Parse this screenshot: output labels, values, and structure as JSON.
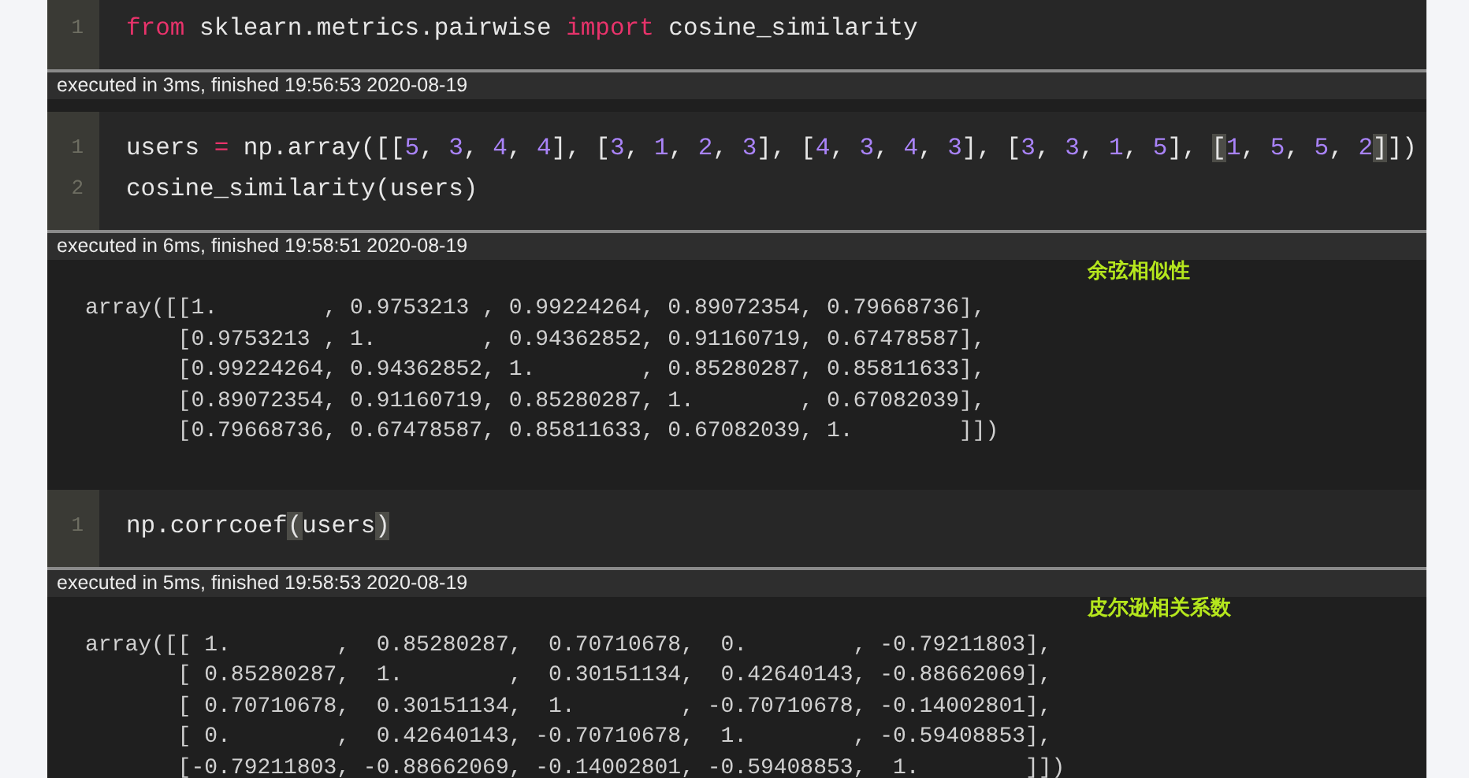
{
  "cells": [
    {
      "input": [
        {
          "number": "1",
          "tokens": [
            {
              "kind": "keyword",
              "text": "from"
            },
            {
              "kind": "plain",
              "text": " sklearn.metrics.pairwise "
            },
            {
              "kind": "keyword",
              "text": "import"
            },
            {
              "kind": "plain",
              "text": " cosine_similarity"
            }
          ]
        }
      ],
      "execution": "executed in 3ms, finished 19:56:53 2020-08-19"
    },
    {
      "input": [
        {
          "number": "1",
          "tokens": [
            {
              "kind": "plain",
              "text": "users "
            },
            {
              "kind": "operator",
              "text": "="
            },
            {
              "kind": "plain",
              "text": " np.array([["
            },
            {
              "kind": "number",
              "text": "5"
            },
            {
              "kind": "plain",
              "text": ", "
            },
            {
              "kind": "number",
              "text": "3"
            },
            {
              "kind": "plain",
              "text": ", "
            },
            {
              "kind": "number",
              "text": "4"
            },
            {
              "kind": "plain",
              "text": ", "
            },
            {
              "kind": "number",
              "text": "4"
            },
            {
              "kind": "plain",
              "text": "], ["
            },
            {
              "kind": "number",
              "text": "3"
            },
            {
              "kind": "plain",
              "text": ", "
            },
            {
              "kind": "number",
              "text": "1"
            },
            {
              "kind": "plain",
              "text": ", "
            },
            {
              "kind": "number",
              "text": "2"
            },
            {
              "kind": "plain",
              "text": ", "
            },
            {
              "kind": "number",
              "text": "3"
            },
            {
              "kind": "plain",
              "text": "], ["
            },
            {
              "kind": "number",
              "text": "4"
            },
            {
              "kind": "plain",
              "text": ", "
            },
            {
              "kind": "number",
              "text": "3"
            },
            {
              "kind": "plain",
              "text": ", "
            },
            {
              "kind": "number",
              "text": "4"
            },
            {
              "kind": "plain",
              "text": ", "
            },
            {
              "kind": "number",
              "text": "3"
            },
            {
              "kind": "plain",
              "text": "], ["
            },
            {
              "kind": "number",
              "text": "3"
            },
            {
              "kind": "plain",
              "text": ", "
            },
            {
              "kind": "number",
              "text": "3"
            },
            {
              "kind": "plain",
              "text": ", "
            },
            {
              "kind": "number",
              "text": "1"
            },
            {
              "kind": "plain",
              "text": ", "
            },
            {
              "kind": "number",
              "text": "5"
            },
            {
              "kind": "plain",
              "text": "], "
            },
            {
              "kind": "match",
              "text": "["
            },
            {
              "kind": "number",
              "text": "1"
            },
            {
              "kind": "plain",
              "text": ", "
            },
            {
              "kind": "number",
              "text": "5"
            },
            {
              "kind": "plain",
              "text": ", "
            },
            {
              "kind": "number",
              "text": "5"
            },
            {
              "kind": "plain",
              "text": ", "
            },
            {
              "kind": "number",
              "text": "2"
            },
            {
              "kind": "match",
              "text": "]"
            },
            {
              "kind": "plain",
              "text": "])"
            }
          ]
        },
        {
          "number": "2",
          "tokens": [
            {
              "kind": "plain",
              "text": "cosine_similarity(users)"
            }
          ]
        }
      ],
      "execution": "executed in 6ms, finished 19:58:51 2020-08-19",
      "output": {
        "note": "余弦相似性",
        "lines": [
          "array([[1.        , 0.9753213 , 0.99224264, 0.89072354, 0.79668736],",
          "       [0.9753213 , 1.        , 0.94362852, 0.91160719, 0.67478587],",
          "       [0.99224264, 0.94362852, 1.        , 0.85280287, 0.85811633],",
          "       [0.89072354, 0.91160719, 0.85280287, 1.        , 0.67082039],",
          "       [0.79668736, 0.67478587, 0.85811633, 0.67082039, 1.        ]])"
        ]
      }
    },
    {
      "input": [
        {
          "number": "1",
          "tokens": [
            {
              "kind": "plain",
              "text": "np.corrcoef"
            },
            {
              "kind": "match",
              "text": "("
            },
            {
              "kind": "plain",
              "text": "users"
            },
            {
              "kind": "match",
              "text": ")"
            }
          ]
        }
      ],
      "execution": "executed in 5ms, finished 19:58:53 2020-08-19",
      "output": {
        "note": "皮尔逊相关系数",
        "lines": [
          "array([[ 1.        ,  0.85280287,  0.70710678,  0.        , -0.79211803],",
          "       [ 0.85280287,  1.        ,  0.30151134,  0.42640143, -0.88662069],",
          "       [ 0.70710678,  0.30151134,  1.        , -0.70710678, -0.14002801],",
          "       [ 0.        ,  0.42640143, -0.70710678,  1.        , -0.59408853],",
          "       [-0.79211803, -0.88662069, -0.14002801, -0.59408853,  1.        ]])"
        ]
      }
    }
  ]
}
